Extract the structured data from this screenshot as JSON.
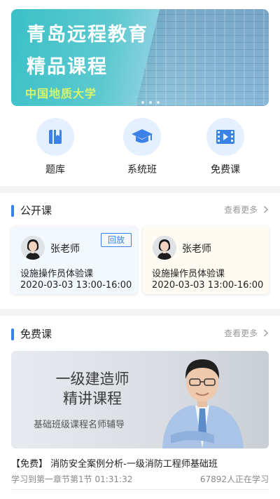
{
  "banner": {
    "line1": "青岛远程教育",
    "line2": "精品课程",
    "university": "中国地质大学",
    "slide_count": 3
  },
  "categories": [
    {
      "label": "题库",
      "icon": "book-icon"
    },
    {
      "label": "系统班",
      "icon": "graduation-cap-icon"
    },
    {
      "label": "免费课",
      "icon": "video-icon"
    }
  ],
  "open_course": {
    "title": "公开课",
    "more": "查看更多",
    "cards": [
      {
        "teacher": "张老师",
        "badge": "回放",
        "course": "设施操作员体验课",
        "time": "2020-03-03  13:00-16:00"
      },
      {
        "teacher": "张老师",
        "course": "设施操作员体验课",
        "time": "2020-03-03  13:00-16:00"
      }
    ]
  },
  "free_course": {
    "title": "免费课",
    "more": "查看更多",
    "video_title_line1": "一级建造师",
    "video_title_line2": "精讲课程",
    "video_subtitle": "基础班级课程名师辅导",
    "course_title": "【免费】 消防安全案例分析-一级消防工程师基础班",
    "progress": "学习到第一章节第1节 01:31:32",
    "learners": "67892人正在学习"
  },
  "colors": {
    "accent": "#3b82e6",
    "icon_bg": "#e4efff",
    "separator": "#f3f3f3"
  }
}
